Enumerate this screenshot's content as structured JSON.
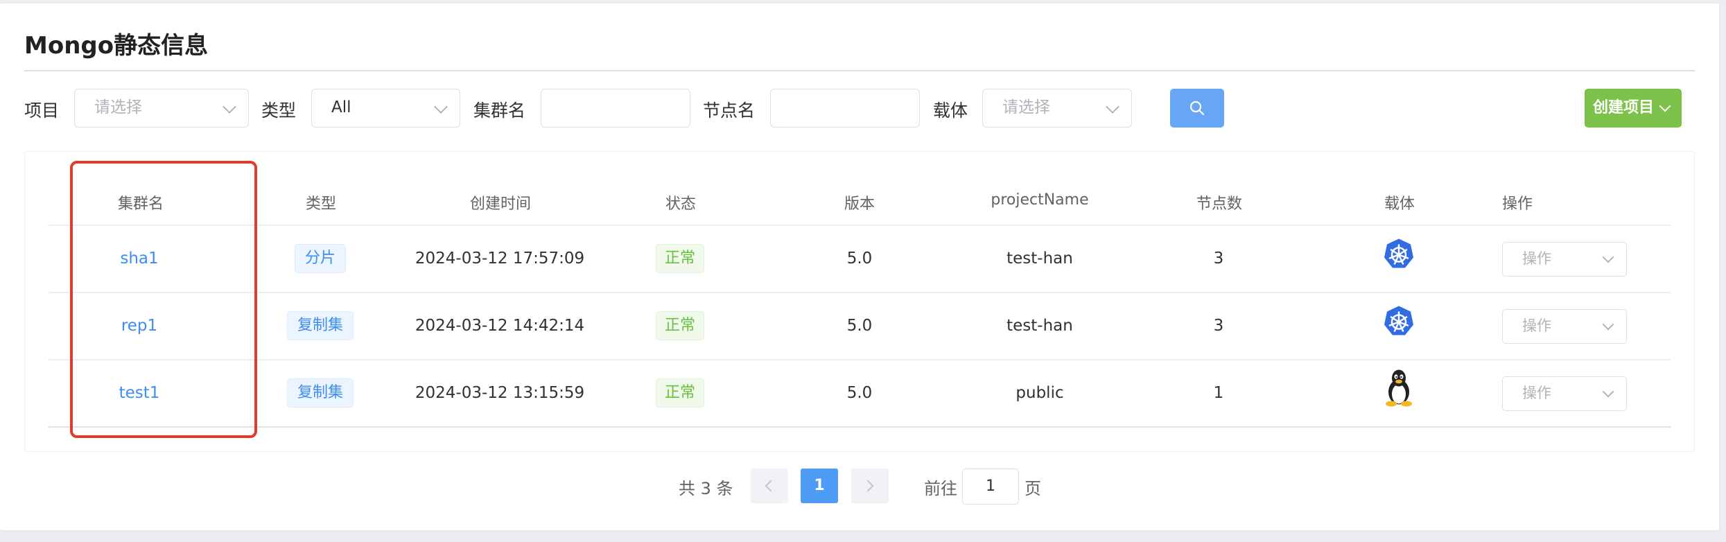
{
  "page": {
    "title": "Mongo静态信息"
  },
  "filters": {
    "project_label": "项目",
    "project_placeholder": "请选择",
    "type_label": "类型",
    "type_value": "All",
    "cluster_label": "集群名",
    "cluster_value": "",
    "node_label": "节点名",
    "node_value": "",
    "carrier_label": "载体",
    "carrier_placeholder": "请选择"
  },
  "toolbar": {
    "search_icon": "search-icon",
    "create_label": "创建项目",
    "create_icon": "chevron-down-icon"
  },
  "colors": {
    "primary": "#4e9cf5",
    "success": "#67c23a",
    "create_button": "#7cc24a",
    "highlight_border": "#e03c2c"
  },
  "table": {
    "headers": [
      "集群名",
      "类型",
      "创建时间",
      "状态",
      "版本",
      "projectName",
      "节点数",
      "载体",
      "操作"
    ],
    "rows": [
      {
        "cluster": "sha1",
        "type": "分片",
        "created": "2024-03-12 17:57:09",
        "status": "正常",
        "version": "5.0",
        "project": "test-han",
        "nodes": "3",
        "carrier_icon": "kubernetes-icon",
        "action": "操作"
      },
      {
        "cluster": "rep1",
        "type": "复制集",
        "created": "2024-03-12 14:42:14",
        "status": "正常",
        "version": "5.0",
        "project": "test-han",
        "nodes": "3",
        "carrier_icon": "kubernetes-icon",
        "action": "操作"
      },
      {
        "cluster": "test1",
        "type": "复制集",
        "created": "2024-03-12 13:15:59",
        "status": "正常",
        "version": "5.0",
        "project": "public",
        "nodes": "1",
        "carrier_icon": "linux-penguin-icon",
        "action": "操作"
      }
    ]
  },
  "pagination": {
    "total_text": "共 3 条",
    "current_page": "1",
    "goto_prefix": "前往",
    "goto_value": "1",
    "goto_suffix": "页"
  }
}
